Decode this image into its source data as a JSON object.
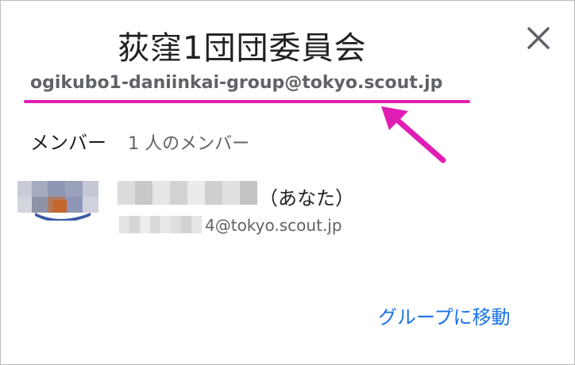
{
  "dialog": {
    "title": "荻窪1団団委員会",
    "group_email": "ogikubo1-daniinkai-group@tokyo.scout.jp",
    "close_icon": "close-icon"
  },
  "members": {
    "heading": "メンバー",
    "count": "1 人のメンバー",
    "list": [
      {
        "you_label": "（あなた）",
        "email_suffix": "4@tokyo.scout.jp",
        "avatar_icon": "avatar"
      }
    ]
  },
  "actions": {
    "go_to_group": "グループに移動"
  },
  "colors": {
    "highlight": "#e01eb4",
    "link": "#1a73e8",
    "text": "#202124",
    "secondary": "#5f6368"
  }
}
